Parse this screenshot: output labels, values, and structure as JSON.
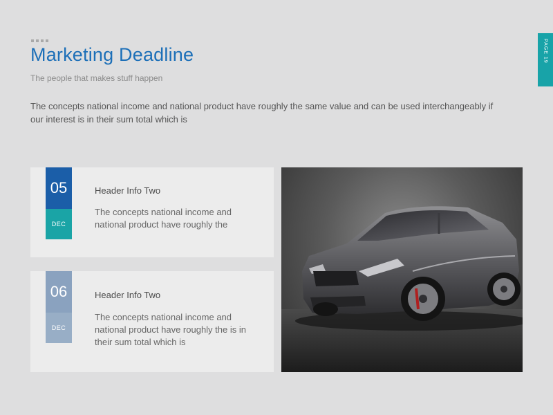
{
  "header": {
    "title": "Marketing Deadline",
    "subtitle": "The people that makes stuff happen",
    "intro": "The concepts national income and national product have roughly the same value and can be used interchangeably if our interest is in their sum total which is"
  },
  "page_tab": {
    "label": "PAGE 19"
  },
  "cards": [
    {
      "day": "05",
      "month": "DEC",
      "heading": "Header Info Two",
      "body": "The concepts national income and national product have roughly the"
    },
    {
      "day": "06",
      "month": "DEC",
      "heading": "Header Info Two",
      "body": "The concepts national income and national product have roughly the is in their sum total which is"
    }
  ],
  "colors": {
    "accent_blue": "#1b5ea8",
    "accent_teal": "#18a3a8",
    "muted_blue": "#8aa2bf",
    "title_blue": "#1c6fb8"
  },
  "image": {
    "subject": "car-photo"
  }
}
